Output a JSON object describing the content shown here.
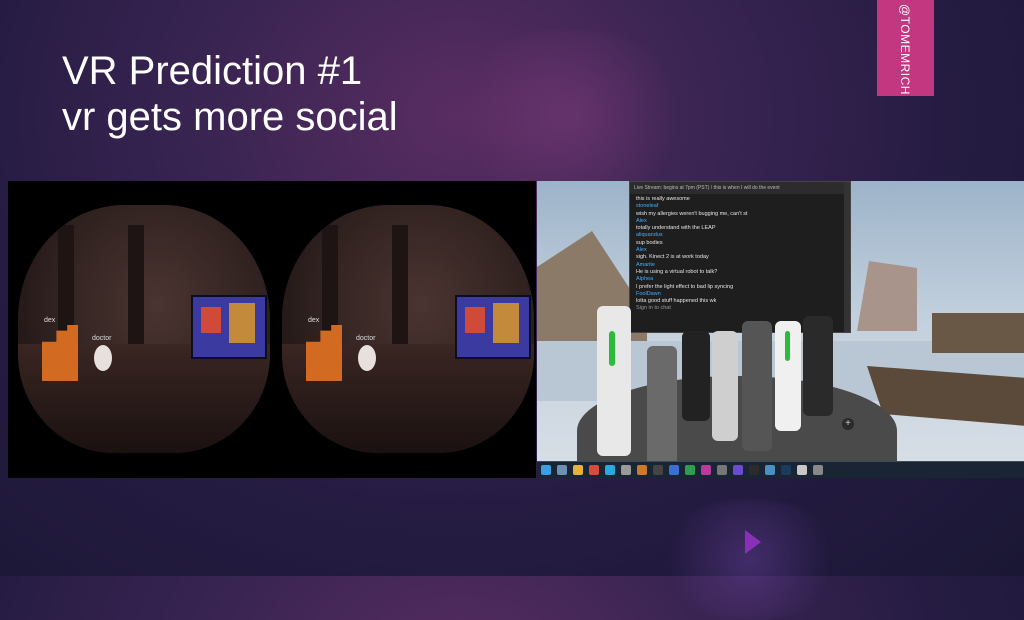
{
  "slide": {
    "title_line1": "VR Prediction #1",
    "title_line2": "vr gets more social",
    "twitter_handle": "@TOMEMRICH"
  },
  "left_panel": {
    "eye_label": "dex",
    "avatar_label": "doctor"
  },
  "chat_window": {
    "header": "Live Stream: begins at 7pm (PST) / this is when I will do the event",
    "lines": [
      {
        "kind": "msg",
        "text": "this is really awesome"
      },
      {
        "kind": "name",
        "text": "stoneleaf"
      },
      {
        "kind": "msg",
        "text": "wish my allergies weren't bugging me, can't st"
      },
      {
        "kind": "name",
        "text": "Alex"
      },
      {
        "kind": "msg",
        "text": "totally understand with the LEAP"
      },
      {
        "kind": "name",
        "text": "aliquandus"
      },
      {
        "kind": "msg",
        "text": "sup bodies"
      },
      {
        "kind": "name",
        "text": "Alex"
      },
      {
        "kind": "msg",
        "text": "sigh. Kinect 2 is at work today"
      },
      {
        "kind": "name",
        "text": "Amarite"
      },
      {
        "kind": "msg",
        "text": "He is using a virtual robot to talk?"
      },
      {
        "kind": "name",
        "text": "Alphea"
      },
      {
        "kind": "msg",
        "text": "I prefer the light effect to bad lip syncing"
      },
      {
        "kind": "name",
        "text": "FoolDawn"
      },
      {
        "kind": "msg",
        "text": "lotta good stuff happened this wk"
      },
      {
        "kind": "foot",
        "text": "Sign in to chat"
      }
    ]
  },
  "colors": {
    "accent_tag": "#c2377f",
    "title_text": "#ffffff",
    "chat_name": "#3fb0ff"
  },
  "icons": [
    "start-icon",
    "search-icon",
    "file-explorer-icon",
    "chrome-icon",
    "skype-icon",
    "steam-icon"
  ]
}
